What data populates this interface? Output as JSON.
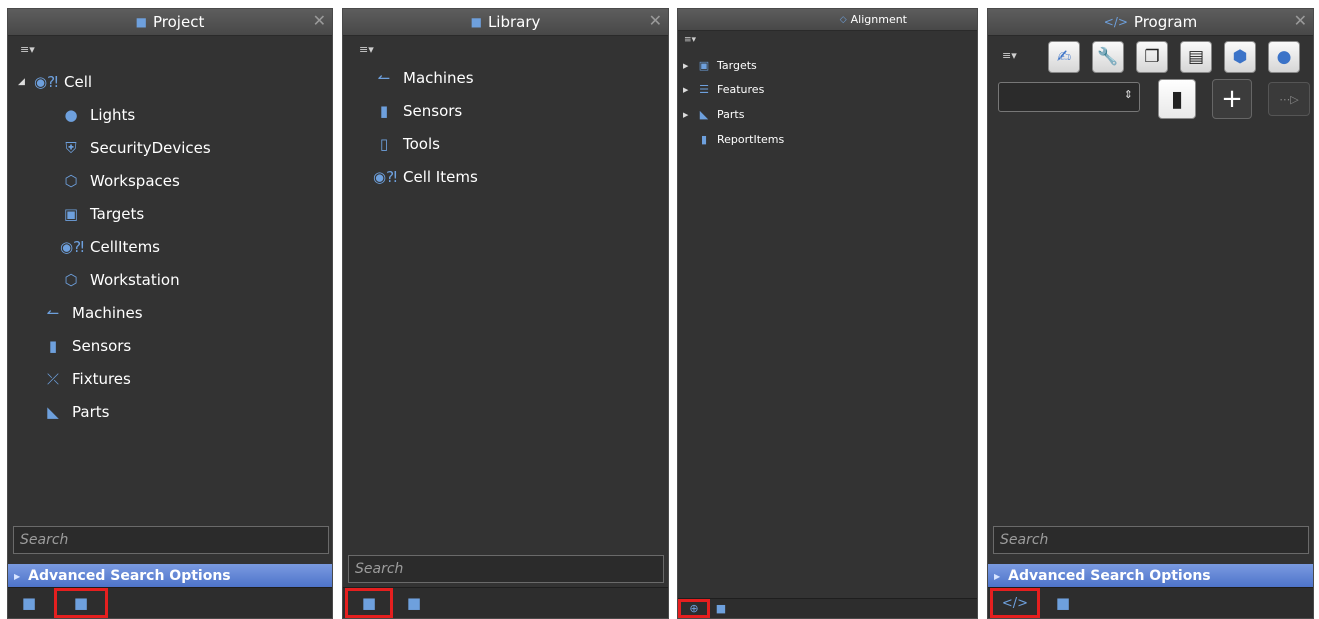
{
  "project": {
    "title": "Project",
    "items": [
      {
        "label": "Cell"
      },
      {
        "label": "Lights"
      },
      {
        "label": "SecurityDevices"
      },
      {
        "label": "Workspaces"
      },
      {
        "label": "Targets"
      },
      {
        "label": "CellItems"
      },
      {
        "label": "Workstation"
      },
      {
        "label": "Machines"
      },
      {
        "label": "Sensors"
      },
      {
        "label": "Fixtures"
      },
      {
        "label": "Parts"
      }
    ],
    "search_placeholder": "Search",
    "advanced_label": "Advanced Search Options"
  },
  "library": {
    "title": "Library",
    "items": [
      {
        "label": "Machines"
      },
      {
        "label": "Sensors"
      },
      {
        "label": "Tools"
      },
      {
        "label": "Cell Items"
      }
    ],
    "search_placeholder": "Search"
  },
  "alignment": {
    "title": "Alignment",
    "items": [
      {
        "label": "Targets"
      },
      {
        "label": "Features"
      },
      {
        "label": "Parts"
      },
      {
        "label": "ReportItems"
      }
    ]
  },
  "program": {
    "title": "Program",
    "search_placeholder": "Search",
    "advanced_label": "Advanced Search Options"
  },
  "colors": {
    "panel_bg": "#333333",
    "accent_icon": "#6ea0dd",
    "highlight": "#e51f1f",
    "advanced_bar": "#5a7fd4"
  },
  "icons": [
    "list-menu-icon",
    "folder-icon",
    "robot-arm-icon",
    "sensor-icon",
    "tool-icon",
    "cell-items-icon",
    "lightbulb-icon",
    "shield-icon",
    "cube-outline-icon",
    "target-camera-icon",
    "fixture-icon",
    "part-icon",
    "feature-list-icon",
    "report-icon",
    "code-icon",
    "trash-icon",
    "plus-icon",
    "copy-icon",
    "clipboard-icon",
    "wrench-icon",
    "hand-icon",
    "crosshair-icon"
  ]
}
